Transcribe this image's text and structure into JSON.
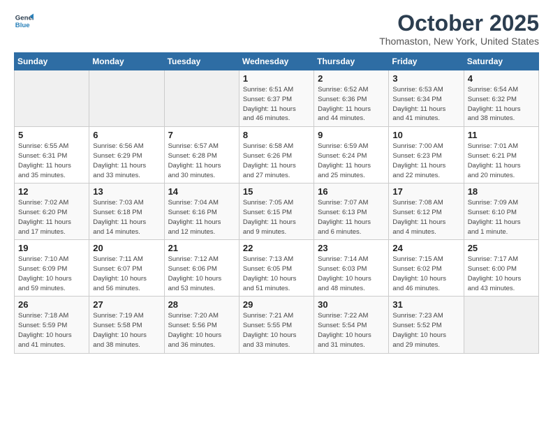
{
  "logo": {
    "general": "General",
    "blue": "Blue"
  },
  "header": {
    "month": "October 2025",
    "location": "Thomaston, New York, United States"
  },
  "days_of_week": [
    "Sunday",
    "Monday",
    "Tuesday",
    "Wednesday",
    "Thursday",
    "Friday",
    "Saturday"
  ],
  "weeks": [
    [
      {
        "day": "",
        "info": ""
      },
      {
        "day": "",
        "info": ""
      },
      {
        "day": "",
        "info": ""
      },
      {
        "day": "1",
        "info": "Sunrise: 6:51 AM\nSunset: 6:37 PM\nDaylight: 11 hours\nand 46 minutes."
      },
      {
        "day": "2",
        "info": "Sunrise: 6:52 AM\nSunset: 6:36 PM\nDaylight: 11 hours\nand 44 minutes."
      },
      {
        "day": "3",
        "info": "Sunrise: 6:53 AM\nSunset: 6:34 PM\nDaylight: 11 hours\nand 41 minutes."
      },
      {
        "day": "4",
        "info": "Sunrise: 6:54 AM\nSunset: 6:32 PM\nDaylight: 11 hours\nand 38 minutes."
      }
    ],
    [
      {
        "day": "5",
        "info": "Sunrise: 6:55 AM\nSunset: 6:31 PM\nDaylight: 11 hours\nand 35 minutes."
      },
      {
        "day": "6",
        "info": "Sunrise: 6:56 AM\nSunset: 6:29 PM\nDaylight: 11 hours\nand 33 minutes."
      },
      {
        "day": "7",
        "info": "Sunrise: 6:57 AM\nSunset: 6:28 PM\nDaylight: 11 hours\nand 30 minutes."
      },
      {
        "day": "8",
        "info": "Sunrise: 6:58 AM\nSunset: 6:26 PM\nDaylight: 11 hours\nand 27 minutes."
      },
      {
        "day": "9",
        "info": "Sunrise: 6:59 AM\nSunset: 6:24 PM\nDaylight: 11 hours\nand 25 minutes."
      },
      {
        "day": "10",
        "info": "Sunrise: 7:00 AM\nSunset: 6:23 PM\nDaylight: 11 hours\nand 22 minutes."
      },
      {
        "day": "11",
        "info": "Sunrise: 7:01 AM\nSunset: 6:21 PM\nDaylight: 11 hours\nand 20 minutes."
      }
    ],
    [
      {
        "day": "12",
        "info": "Sunrise: 7:02 AM\nSunset: 6:20 PM\nDaylight: 11 hours\nand 17 minutes."
      },
      {
        "day": "13",
        "info": "Sunrise: 7:03 AM\nSunset: 6:18 PM\nDaylight: 11 hours\nand 14 minutes."
      },
      {
        "day": "14",
        "info": "Sunrise: 7:04 AM\nSunset: 6:16 PM\nDaylight: 11 hours\nand 12 minutes."
      },
      {
        "day": "15",
        "info": "Sunrise: 7:05 AM\nSunset: 6:15 PM\nDaylight: 11 hours\nand 9 minutes."
      },
      {
        "day": "16",
        "info": "Sunrise: 7:07 AM\nSunset: 6:13 PM\nDaylight: 11 hours\nand 6 minutes."
      },
      {
        "day": "17",
        "info": "Sunrise: 7:08 AM\nSunset: 6:12 PM\nDaylight: 11 hours\nand 4 minutes."
      },
      {
        "day": "18",
        "info": "Sunrise: 7:09 AM\nSunset: 6:10 PM\nDaylight: 11 hours\nand 1 minute."
      }
    ],
    [
      {
        "day": "19",
        "info": "Sunrise: 7:10 AM\nSunset: 6:09 PM\nDaylight: 10 hours\nand 59 minutes."
      },
      {
        "day": "20",
        "info": "Sunrise: 7:11 AM\nSunset: 6:07 PM\nDaylight: 10 hours\nand 56 minutes."
      },
      {
        "day": "21",
        "info": "Sunrise: 7:12 AM\nSunset: 6:06 PM\nDaylight: 10 hours\nand 53 minutes."
      },
      {
        "day": "22",
        "info": "Sunrise: 7:13 AM\nSunset: 6:05 PM\nDaylight: 10 hours\nand 51 minutes."
      },
      {
        "day": "23",
        "info": "Sunrise: 7:14 AM\nSunset: 6:03 PM\nDaylight: 10 hours\nand 48 minutes."
      },
      {
        "day": "24",
        "info": "Sunrise: 7:15 AM\nSunset: 6:02 PM\nDaylight: 10 hours\nand 46 minutes."
      },
      {
        "day": "25",
        "info": "Sunrise: 7:17 AM\nSunset: 6:00 PM\nDaylight: 10 hours\nand 43 minutes."
      }
    ],
    [
      {
        "day": "26",
        "info": "Sunrise: 7:18 AM\nSunset: 5:59 PM\nDaylight: 10 hours\nand 41 minutes."
      },
      {
        "day": "27",
        "info": "Sunrise: 7:19 AM\nSunset: 5:58 PM\nDaylight: 10 hours\nand 38 minutes."
      },
      {
        "day": "28",
        "info": "Sunrise: 7:20 AM\nSunset: 5:56 PM\nDaylight: 10 hours\nand 36 minutes."
      },
      {
        "day": "29",
        "info": "Sunrise: 7:21 AM\nSunset: 5:55 PM\nDaylight: 10 hours\nand 33 minutes."
      },
      {
        "day": "30",
        "info": "Sunrise: 7:22 AM\nSunset: 5:54 PM\nDaylight: 10 hours\nand 31 minutes."
      },
      {
        "day": "31",
        "info": "Sunrise: 7:23 AM\nSunset: 5:52 PM\nDaylight: 10 hours\nand 29 minutes."
      },
      {
        "day": "",
        "info": ""
      }
    ]
  ]
}
